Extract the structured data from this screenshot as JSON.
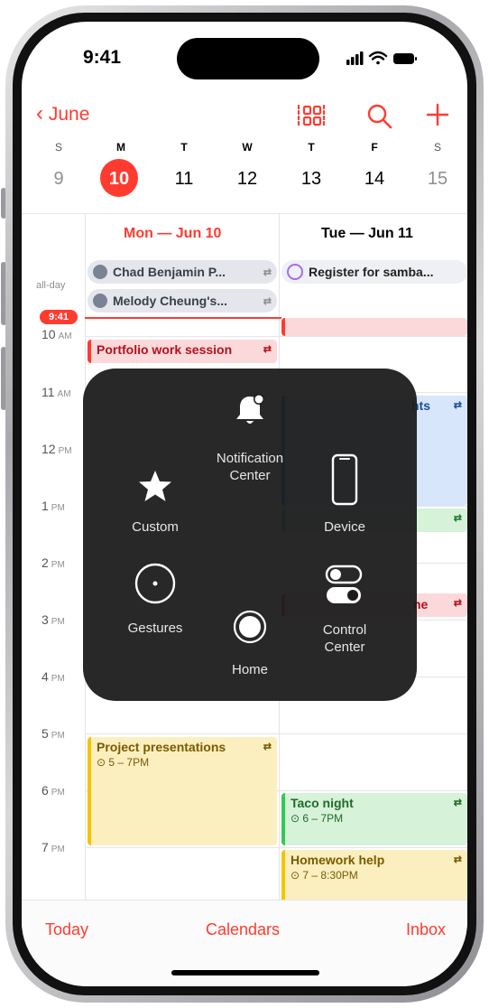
{
  "status_bar": {
    "time": "9:41"
  },
  "nav": {
    "back_label": "June",
    "icons": [
      "back-chevron-icon",
      "day-view-icon",
      "search-icon",
      "add-icon"
    ]
  },
  "week": {
    "weekdays": [
      "S",
      "M",
      "T",
      "W",
      "T",
      "F",
      "S"
    ],
    "dates": [
      "9",
      "10",
      "11",
      "12",
      "13",
      "14",
      "15"
    ],
    "selected_index": 1
  },
  "columns": {
    "day1_title": "Mon — Jun 10",
    "day2_title": "Tue — Jun 11"
  },
  "all_day": {
    "label": "all-day",
    "events": [
      {
        "title": "Chad Benjamin P..."
      },
      {
        "title": "Melody Cheung's..."
      },
      {
        "title": "Register for samba..."
      }
    ]
  },
  "now": {
    "label": "9:41"
  },
  "hours": [
    {
      "num": "10",
      "ampm": "AM"
    },
    {
      "num": "11",
      "ampm": "AM"
    },
    {
      "num": "12",
      "ampm": "PM"
    },
    {
      "num": "1",
      "ampm": "PM"
    },
    {
      "num": "2",
      "ampm": "PM"
    },
    {
      "num": "3",
      "ampm": "PM"
    },
    {
      "num": "4",
      "ampm": "PM"
    },
    {
      "num": "5",
      "ampm": "PM"
    },
    {
      "num": "6",
      "ampm": "PM"
    },
    {
      "num": "7",
      "ampm": "PM"
    }
  ],
  "events": {
    "portfolio": {
      "title": "Portfolio work session"
    },
    "partial_lights": {
      "title": "hts"
    },
    "partial_ne": {
      "title": "ne"
    },
    "project": {
      "title": "Project presentations",
      "time": "5 – 7PM"
    },
    "taco": {
      "title": "Taco night",
      "time": "6 – 7PM"
    },
    "homework": {
      "title": "Homework help",
      "time": "7 – 8:30PM"
    }
  },
  "assistive_touch": {
    "notification_center": "Notification\nCenter",
    "custom": "Custom",
    "device": "Device",
    "gestures": "Gestures",
    "control_center": "Control\nCenter",
    "home": "Home"
  },
  "tab_bar": {
    "today": "Today",
    "calendars": "Calendars",
    "inbox": "Inbox"
  },
  "colors": {
    "accent": "#ff3b30",
    "menu_bg": "#1c1c1e",
    "event_pink": "#fbd9db",
    "event_yellow": "#fbefbf",
    "event_green": "#d6f2d8",
    "event_blue": "#d7e6fb"
  }
}
